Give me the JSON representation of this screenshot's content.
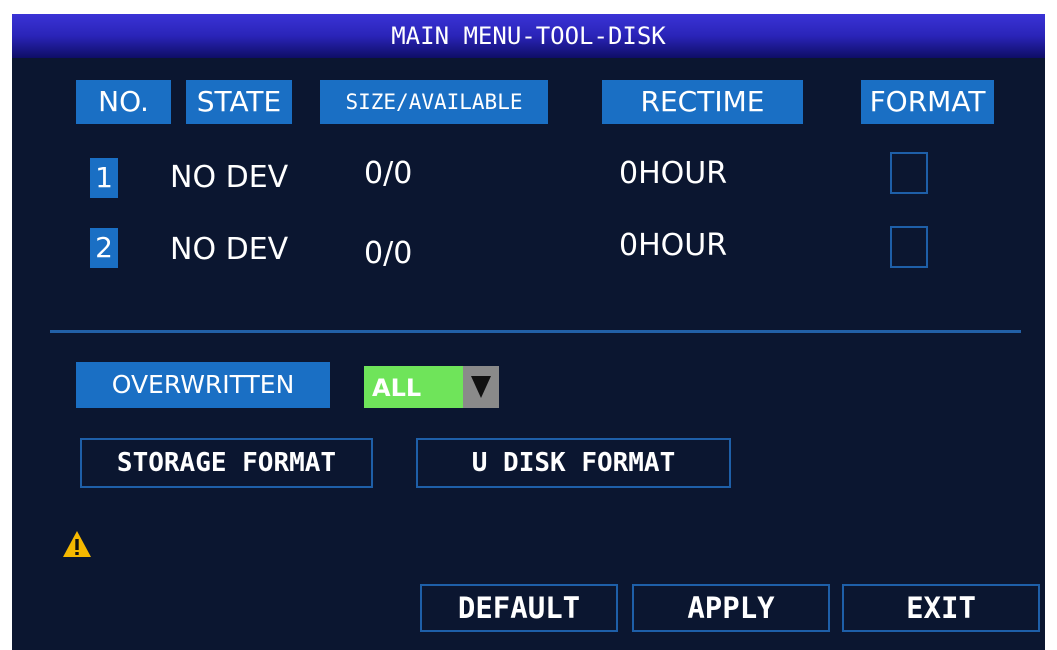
{
  "window": {
    "title": "MAIN MENU-TOOL-DISK"
  },
  "table": {
    "headers": [
      "NO.",
      "STATE",
      "SIZE/AVAILABLE",
      "RECTIME",
      "FORMAT"
    ],
    "rows": [
      {
        "no": "1",
        "state": "NO DEV",
        "size": "0/0",
        "rectime": "0HOUR",
        "format_checked": false
      },
      {
        "no": "2",
        "state": "NO DEV",
        "size": "0/0",
        "rectime": "0HOUR",
        "format_checked": false
      }
    ]
  },
  "overwritten": {
    "label": "OVERWRITTEN",
    "value": "ALL"
  },
  "actions": {
    "storage_format": "STORAGE FORMAT",
    "udisk_format": "U DISK FORMAT"
  },
  "footer": {
    "default": "DEFAULT",
    "apply": "APPLY",
    "exit": "EXIT"
  },
  "icons": {
    "warning": "warning-icon",
    "dropdown": "dropdown-arrow-icon"
  },
  "colors": {
    "background": "#0b1630",
    "header_blue": "#1a6fc4",
    "select_green": "#6fe45a",
    "warning_yellow": "#f5b800"
  }
}
